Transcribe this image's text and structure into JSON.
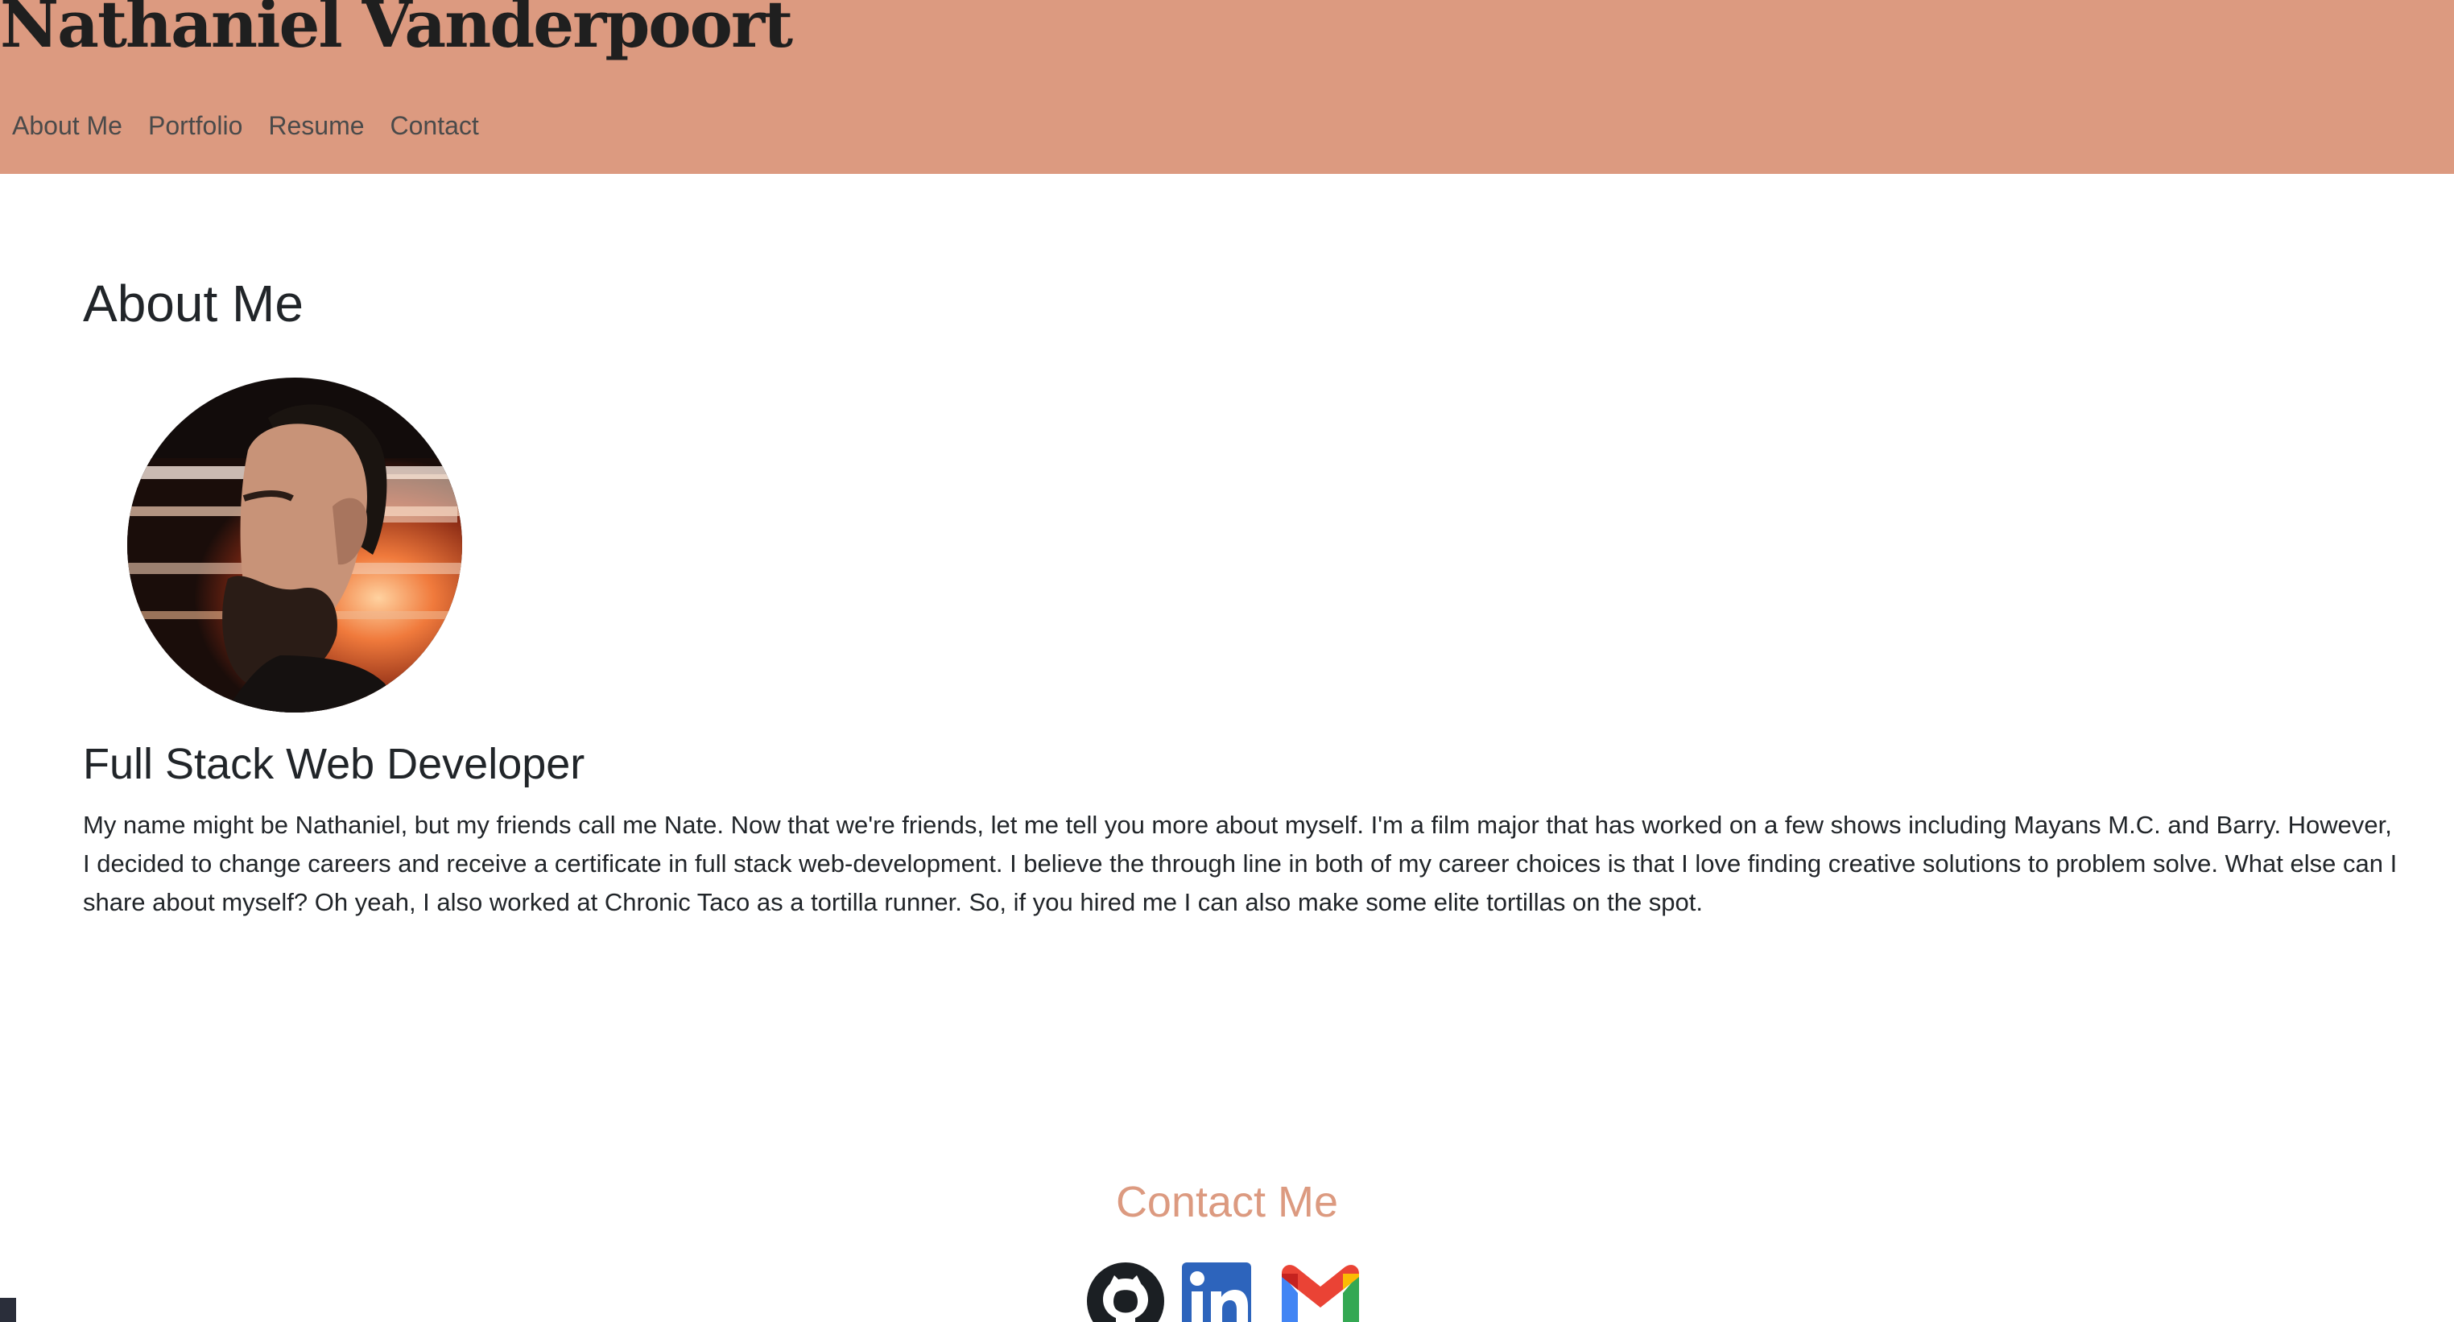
{
  "header": {
    "title": "Nathaniel Vanderpoort",
    "nav": [
      "About Me",
      "Portfolio",
      "Resume",
      "Contact"
    ]
  },
  "about": {
    "heading": "About Me",
    "role": "Full Stack Web Developer",
    "bio": "My name might be Nathaniel, but my friends call me Nate. Now that we're friends, let me tell you more about myself. I'm a film major that has worked on a few shows including Mayans M.C. and Barry. However, I decided to change careers and receive a certificate in full stack web-development. I believe the through line in both of my career choices is that I love finding creative solutions to problem solve. What else can I share about myself? Oh yeah, I also worked at Chronic Taco as a tortilla runner. So, if you hired me I can also make some elite tortillas on the spot."
  },
  "contact": {
    "heading": "Contact Me",
    "icons": [
      "github-icon",
      "linkedin-icon",
      "gmail-icon"
    ]
  },
  "colors": {
    "header_bg": "#dc9a80",
    "accent": "#dc9a80",
    "text": "#212529"
  }
}
